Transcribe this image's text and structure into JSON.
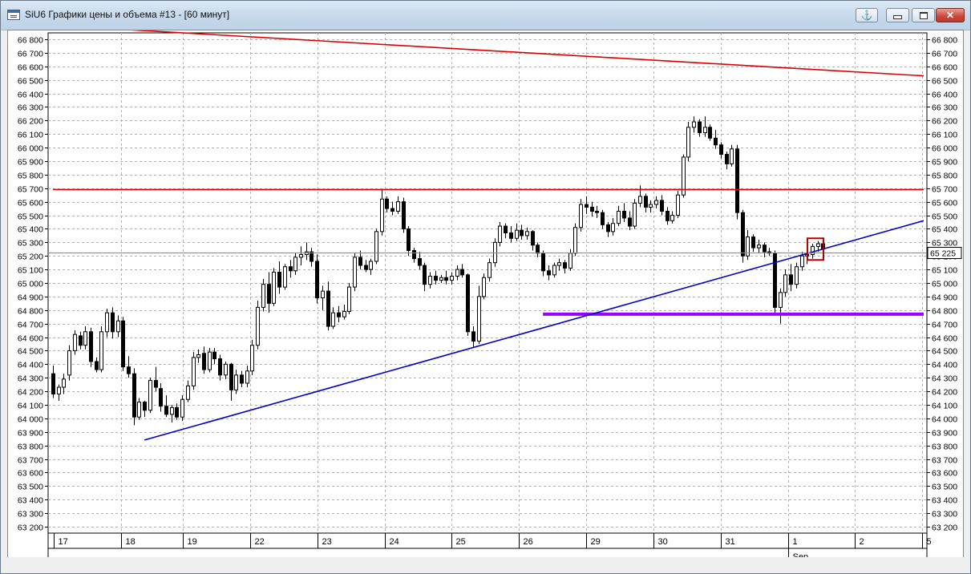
{
  "window": {
    "title": "SiU6 Графики цены и объема #13 - [60 минут]",
    "buttons": {
      "close": "✕"
    }
  },
  "colors": {
    "resistance_top": "#e00000",
    "resistance_mid": "#e00000",
    "trendline": "#0000cc",
    "support": "#9900ff",
    "marker": "#b00000",
    "grid": "#b0b0b0"
  },
  "chart_data": {
    "type": "candlestick",
    "y_axis": {
      "min": 63200,
      "max": 66800,
      "step": 100,
      "labels": [
        "66 800",
        "66 700",
        "66 600",
        "66 500",
        "66 400",
        "66 300",
        "66 200",
        "66 100",
        "66 000",
        "65 900",
        "65 800",
        "65 700",
        "65 600",
        "65 500",
        "65 400",
        "65 300",
        "65 200",
        "65 100",
        "65 000",
        "64 900",
        "64 800",
        "64 700",
        "64 600",
        "64 500",
        "64 400",
        "64 300",
        "64 200",
        "64 100",
        "64 000",
        "63 900",
        "63 800",
        "63 700",
        "63 600",
        "63 500",
        "63 400",
        "63 300",
        "63 200"
      ]
    },
    "last_price": {
      "value": 65225,
      "label": "65 225"
    },
    "x_axis": {
      "dates": [
        "17",
        "18",
        "19",
        "22",
        "23",
        "24",
        "25",
        "26",
        "29",
        "30",
        "31",
        "1",
        "2",
        "5"
      ],
      "month_label": "Sep",
      "month_label_before": "1"
    },
    "lines": [
      {
        "name": "resistance-top",
        "from": [
          10,
          66880
        ],
        "to": [
          162,
          66530
        ]
      },
      {
        "name": "resistance-mid",
        "from": [
          0,
          65690
        ],
        "to": [
          162,
          65690
        ]
      },
      {
        "name": "support",
        "from": [
          91,
          64770
        ],
        "to": [
          162,
          64770
        ]
      },
      {
        "name": "trendline",
        "from": [
          17,
          63840
        ],
        "to": [
          162,
          65460
        ]
      }
    ],
    "candles": [
      [
        64330,
        64390,
        64150,
        64180
      ],
      [
        64180,
        64250,
        64130,
        64230
      ],
      [
        64230,
        64330,
        64180,
        64290
      ],
      [
        64320,
        64540,
        64280,
        64500
      ],
      [
        64500,
        64650,
        64470,
        64620
      ],
      [
        64610,
        64640,
        64510,
        64540
      ],
      [
        64540,
        64680,
        64510,
        64640
      ],
      [
        64640,
        64670,
        64380,
        64420
      ],
      [
        64420,
        64450,
        64340,
        64360
      ],
      [
        64360,
        64680,
        64340,
        64640
      ],
      [
        64640,
        64810,
        64600,
        64780
      ],
      [
        64780,
        64820,
        64590,
        64640
      ],
      [
        64640,
        64760,
        64600,
        64720
      ],
      [
        64720,
        64750,
        64350,
        64380
      ],
      [
        64380,
        64460,
        64300,
        64330
      ],
      [
        64330,
        64370,
        63950,
        64010
      ],
      [
        64010,
        64150,
        63990,
        64120
      ],
      [
        64120,
        64130,
        64010,
        64060
      ],
      [
        64060,
        64300,
        64040,
        64280
      ],
      [
        64280,
        64380,
        64200,
        64230
      ],
      [
        64220,
        64260,
        64050,
        64090
      ],
      [
        64090,
        64170,
        64010,
        64030
      ],
      [
        64030,
        64100,
        63970,
        64080
      ],
      [
        64080,
        64110,
        63990,
        64010
      ],
      [
        64010,
        64170,
        63980,
        64140
      ],
      [
        64140,
        64280,
        64120,
        64240
      ],
      [
        64240,
        64490,
        64210,
        64450
      ],
      [
        64450,
        64510,
        64410,
        64470
      ],
      [
        64480,
        64530,
        64330,
        64360
      ],
      [
        64360,
        64520,
        64340,
        64490
      ],
      [
        64490,
        64520,
        64400,
        64440
      ],
      [
        64440,
        64470,
        64280,
        64320
      ],
      [
        64320,
        64420,
        64290,
        64400
      ],
      [
        64400,
        64410,
        64130,
        64210
      ],
      [
        64210,
        64360,
        64180,
        64320
      ],
      [
        64320,
        64350,
        64230,
        64260
      ],
      [
        64260,
        64390,
        64230,
        64350
      ],
      [
        64350,
        64580,
        64320,
        64540
      ],
      [
        64540,
        64870,
        64510,
        64820
      ],
      [
        64820,
        65030,
        64790,
        64990
      ],
      [
        64990,
        65080,
        64780,
        64850
      ],
      [
        64850,
        65110,
        64830,
        65080
      ],
      [
        65080,
        65160,
        64920,
        64970
      ],
      [
        64970,
        65140,
        64950,
        65120
      ],
      [
        65120,
        65170,
        65040,
        65090
      ],
      [
        65090,
        65220,
        65060,
        65190
      ],
      [
        65190,
        65270,
        65130,
        65210
      ],
      [
        65210,
        65300,
        65170,
        65230
      ],
      [
        65230,
        65260,
        65120,
        65160
      ],
      [
        65160,
        65210,
        64850,
        64890
      ],
      [
        64890,
        64980,
        64800,
        64940
      ],
      [
        64940,
        65010,
        64650,
        64680
      ],
      [
        64680,
        64820,
        64660,
        64780
      ],
      [
        64780,
        64830,
        64710,
        64750
      ],
      [
        64750,
        64840,
        64730,
        64790
      ],
      [
        64790,
        65000,
        64770,
        64970
      ],
      [
        64970,
        65220,
        64940,
        65190
      ],
      [
        65190,
        65240,
        65100,
        65130
      ],
      [
        65130,
        65170,
        65080,
        65100
      ],
      [
        65100,
        65180,
        65060,
        65160
      ],
      [
        65160,
        65400,
        65140,
        65380
      ],
      [
        65380,
        65690,
        65350,
        65620
      ],
      [
        65620,
        65640,
        65520,
        65550
      ],
      [
        65550,
        65600,
        65500,
        65530
      ],
      [
        65530,
        65640,
        65510,
        65600
      ],
      [
        65600,
        65630,
        65370,
        65400
      ],
      [
        65400,
        65420,
        65200,
        65240
      ],
      [
        65240,
        65260,
        65150,
        65180
      ],
      [
        65180,
        65230,
        65100,
        65130
      ],
      [
        65130,
        65150,
        64940,
        64990
      ],
      [
        64990,
        65080,
        64960,
        65050
      ],
      [
        65050,
        65090,
        64990,
        65020
      ],
      [
        65020,
        65060,
        65000,
        65040
      ],
      [
        65040,
        65090,
        64990,
        65020
      ],
      [
        65020,
        65080,
        64990,
        65050
      ],
      [
        65050,
        65130,
        65020,
        65100
      ],
      [
        65100,
        65140,
        65040,
        65060
      ],
      [
        65060,
        65070,
        64610,
        64640
      ],
      [
        64640,
        64680,
        64520,
        64570
      ],
      [
        64570,
        64980,
        64550,
        64900
      ],
      [
        64900,
        65070,
        64880,
        65040
      ],
      [
        65040,
        65180,
        65010,
        65150
      ],
      [
        65150,
        65330,
        65120,
        65300
      ],
      [
        65300,
        65450,
        65270,
        65420
      ],
      [
        65420,
        65440,
        65330,
        65370
      ],
      [
        65370,
        65420,
        65300,
        65330
      ],
      [
        65330,
        65440,
        65310,
        65390
      ],
      [
        65390,
        65430,
        65320,
        65350
      ],
      [
        65350,
        65410,
        65320,
        65380
      ],
      [
        65380,
        65390,
        65240,
        65280
      ],
      [
        65280,
        65300,
        65190,
        65220
      ],
      [
        65220,
        65240,
        65050,
        65090
      ],
      [
        65090,
        65130,
        65020,
        65060
      ],
      [
        65060,
        65150,
        65040,
        65130
      ],
      [
        65130,
        65180,
        65090,
        65150
      ],
      [
        65150,
        65170,
        65070,
        65110
      ],
      [
        65110,
        65250,
        65090,
        65220
      ],
      [
        65220,
        65440,
        65200,
        65410
      ],
      [
        65410,
        65620,
        65380,
        65580
      ],
      [
        65580,
        65640,
        65510,
        65560
      ],
      [
        65560,
        65600,
        65490,
        65530
      ],
      [
        65530,
        65570,
        65480,
        65520
      ],
      [
        65520,
        65540,
        65400,
        65430
      ],
      [
        65430,
        65450,
        65340,
        65380
      ],
      [
        65380,
        65480,
        65350,
        65440
      ],
      [
        65440,
        65570,
        65420,
        65530
      ],
      [
        65530,
        65590,
        65450,
        65480
      ],
      [
        65480,
        65530,
        65390,
        65420
      ],
      [
        65420,
        65620,
        65400,
        65590
      ],
      [
        65590,
        65720,
        65560,
        65640
      ],
      [
        65640,
        65660,
        65520,
        65560
      ],
      [
        65560,
        65610,
        65520,
        65580
      ],
      [
        65580,
        65640,
        65550,
        65610
      ],
      [
        65610,
        65650,
        65500,
        65530
      ],
      [
        65530,
        65560,
        65430,
        65460
      ],
      [
        65460,
        65530,
        65440,
        65500
      ],
      [
        65500,
        65680,
        65480,
        65650
      ],
      [
        65650,
        65950,
        65630,
        65930
      ],
      [
        65930,
        66190,
        65900,
        66150
      ],
      [
        66150,
        66230,
        66110,
        66190
      ],
      [
        66190,
        66210,
        66080,
        66110
      ],
      [
        66110,
        66230,
        66080,
        66150
      ],
      [
        66150,
        66170,
        66050,
        66070
      ],
      [
        66070,
        66130,
        65990,
        66020
      ],
      [
        66020,
        66040,
        65920,
        65950
      ],
      [
        65950,
        65970,
        65840,
        65880
      ],
      [
        65880,
        66020,
        65860,
        65990
      ],
      [
        65990,
        66020,
        65470,
        65520
      ],
      [
        65520,
        65540,
        65150,
        65200
      ],
      [
        65200,
        65390,
        65170,
        65340
      ],
      [
        65340,
        65360,
        65230,
        65260
      ],
      [
        65260,
        65320,
        65220,
        65280
      ],
      [
        65280,
        65300,
        65190,
        65230
      ],
      [
        65230,
        65260,
        65200,
        65220
      ],
      [
        65220,
        65240,
        64770,
        64820
      ],
      [
        64820,
        64960,
        64700,
        64930
      ],
      [
        64930,
        65100,
        64900,
        65060
      ],
      [
        65060,
        65140,
        64940,
        64990
      ],
      [
        64990,
        65150,
        64960,
        65120
      ],
      [
        65120,
        65230,
        65090,
        65200
      ],
      [
        65200,
        65260,
        65140,
        65210
      ],
      [
        65210,
        65290,
        65180,
        65270
      ],
      [
        65270,
        65310,
        65230,
        65290
      ],
      [
        65290,
        65310,
        65230,
        65250
      ]
    ]
  }
}
